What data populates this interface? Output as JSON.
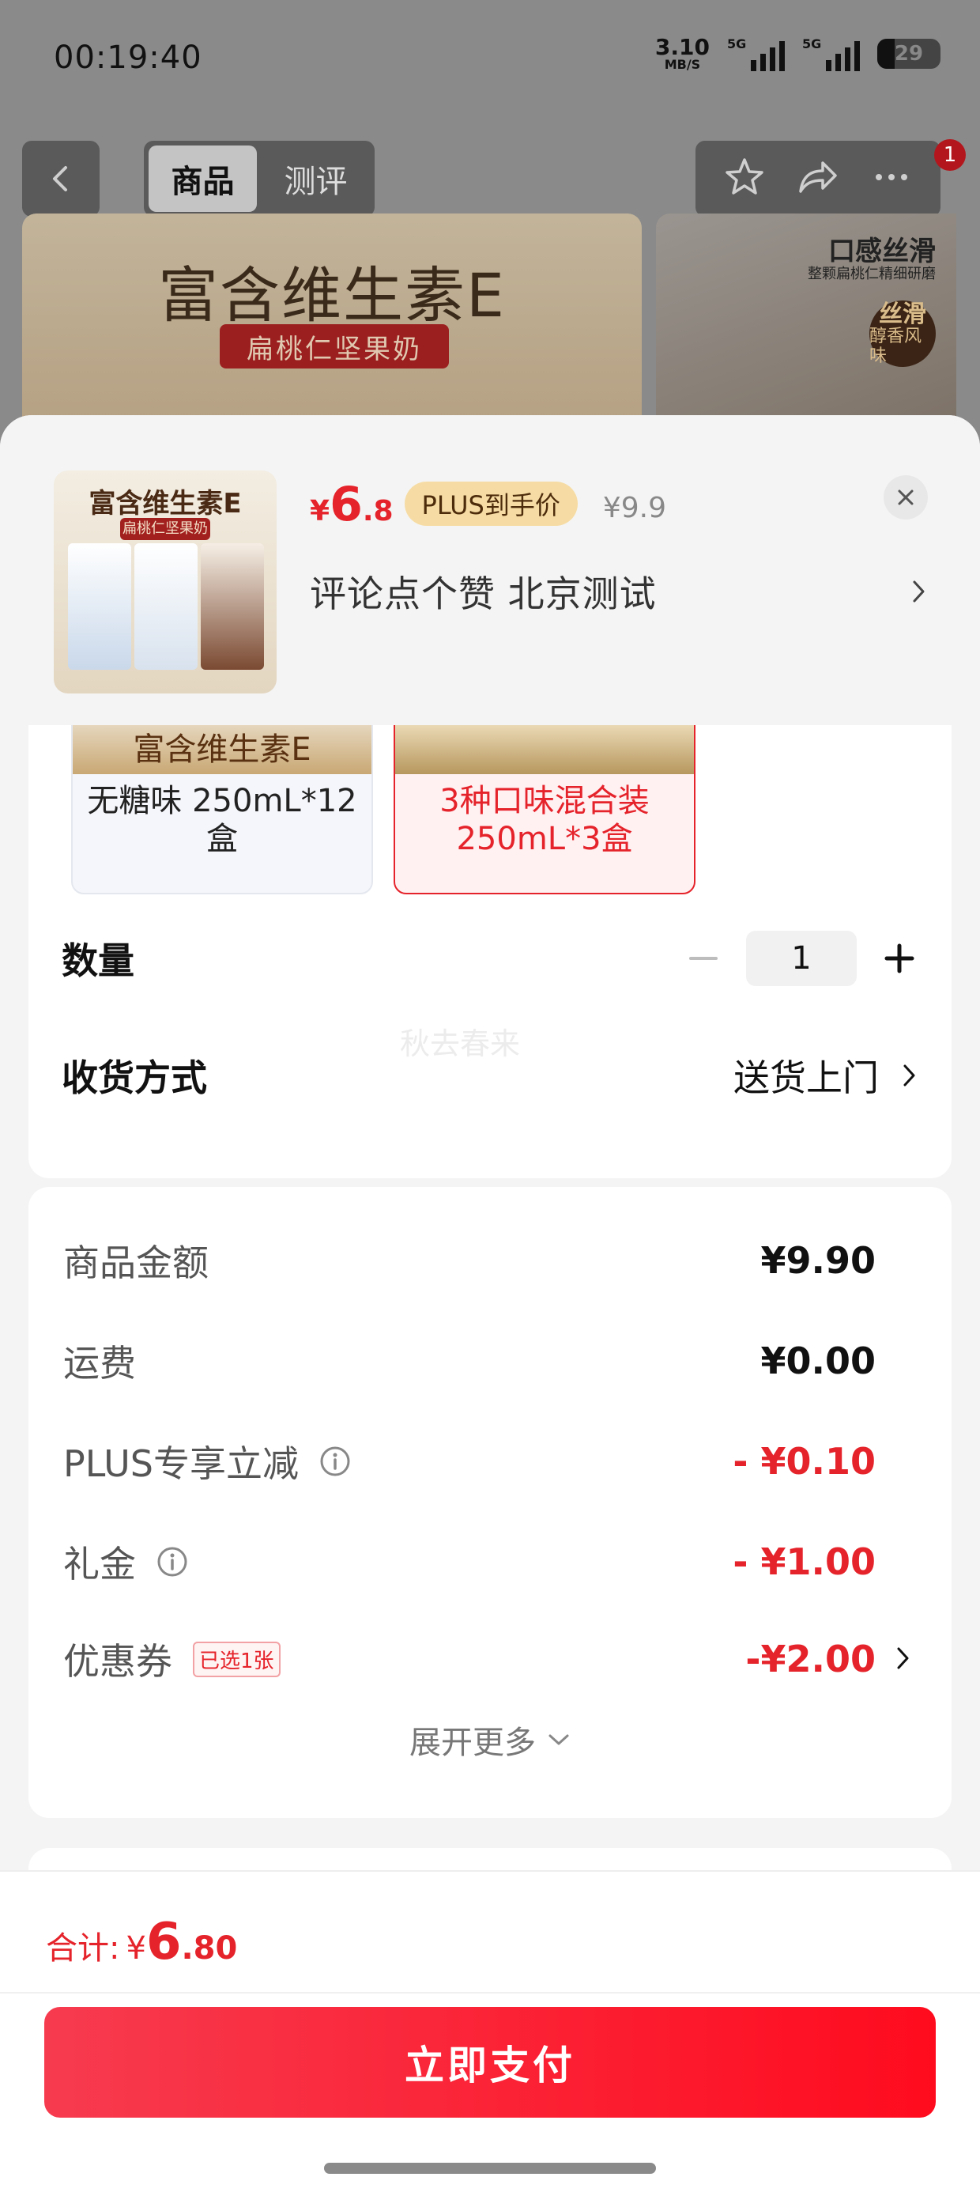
{
  "status_bar": {
    "time": "00:19:40",
    "net_speed_value": "3.10",
    "net_speed_unit": "MB/S",
    "signal1_label": "5G",
    "signal2_label": "5G",
    "battery": "29"
  },
  "nav": {
    "tabs": [
      {
        "label": "商品"
      },
      {
        "label": "测评"
      }
    ],
    "badge_count": "1"
  },
  "banner": {
    "title": "富含维生素E",
    "subtitle": "扁桃仁坚果奶",
    "side_title": "口感丝滑",
    "side_subtitle": "整颗扁桃仁精细研磨",
    "seal_top": "丝滑",
    "seal_bottom": "醇香风味"
  },
  "product": {
    "thumb_title": "富含维生素E",
    "thumb_subtitle": "扁桃仁坚果奶",
    "price_currency": "¥",
    "price_int": "6",
    "price_dec": ".8",
    "plus_tag": "PLUS到手价",
    "original_price": "¥9.9",
    "address": "评论点个赞  北京测试"
  },
  "variants": [
    {
      "banner_text": "富含维生素E",
      "name": "无糖味 250mL*12盒"
    },
    {
      "name": "3种口味混合装250mL*3盒"
    }
  ],
  "quantity": {
    "label": "数量",
    "value": "1"
  },
  "watermark": "秋去春来",
  "delivery": {
    "label": "收货方式",
    "value": "送货上门"
  },
  "fees": [
    {
      "label": "商品金额",
      "value": "¥9.90"
    },
    {
      "label": "运费",
      "value": "¥0.00"
    },
    {
      "label": "PLUS专享立减",
      "value": "- ¥0.10"
    },
    {
      "label": "礼金",
      "value": "- ¥1.00"
    },
    {
      "label": "优惠券",
      "tag": "已选1张",
      "value": "-¥2.00"
    }
  ],
  "expand_label": "展开更多",
  "footer": {
    "total_label": "合计:",
    "total_currency": "¥",
    "total_int": "6",
    "total_dec": ".80",
    "pay_label": "立即支付"
  },
  "colors": {
    "accent_red": "#e5232a",
    "plus_gold": "#f6dca4"
  }
}
